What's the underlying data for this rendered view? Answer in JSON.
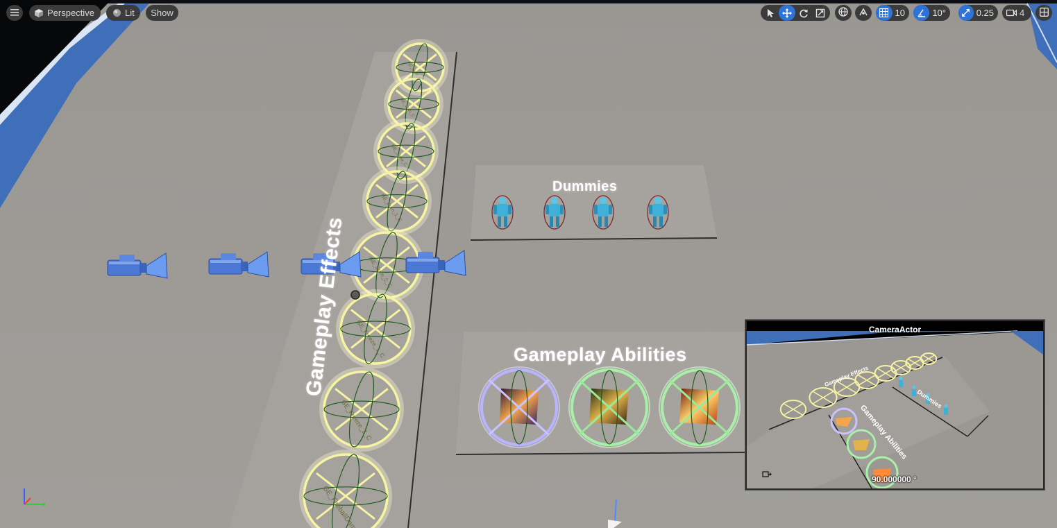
{
  "toolbar": {
    "view_mode": "Perspective",
    "lighting": "Lit",
    "show": "Show",
    "grid_snap_value": "10",
    "rotation_snap_value": "10°",
    "scale_snap_value": "0.25",
    "camera_speed_value": "4"
  },
  "scene": {
    "effects_label": "Gameplay Effects",
    "dummies_label": "Dummies",
    "abilities_label": "Gameplay Abilities",
    "effect_names": [
      "GE_Heal_C",
      "GE_Stun_C",
      "GE_Slow_C",
      "GE_Burn_1_C",
      "GE_Burn_2_C",
      "GE_Freeze_1_C",
      "GE_Freeze_2_C",
      "GE_FireballDamage_C"
    ]
  },
  "pip": {
    "title": "CameraActor",
    "fov": "90.000000 °",
    "effects_label": "Gameplay Effects",
    "dummies_label": "Dummies",
    "abilities_label": "Gameplay Abilities"
  },
  "colors": {
    "toolbar_bg": "#3b3b3b",
    "active_blue": "#2e73d8",
    "floor": "#9c9995",
    "effect_ring": "#f6f3a2",
    "ability_ring_purple": "#b9b4ff",
    "ability_ring_green": "#a8f0a8",
    "dummy_cyan": "#3fb0d8",
    "camera_blue": "#4a78d4"
  }
}
